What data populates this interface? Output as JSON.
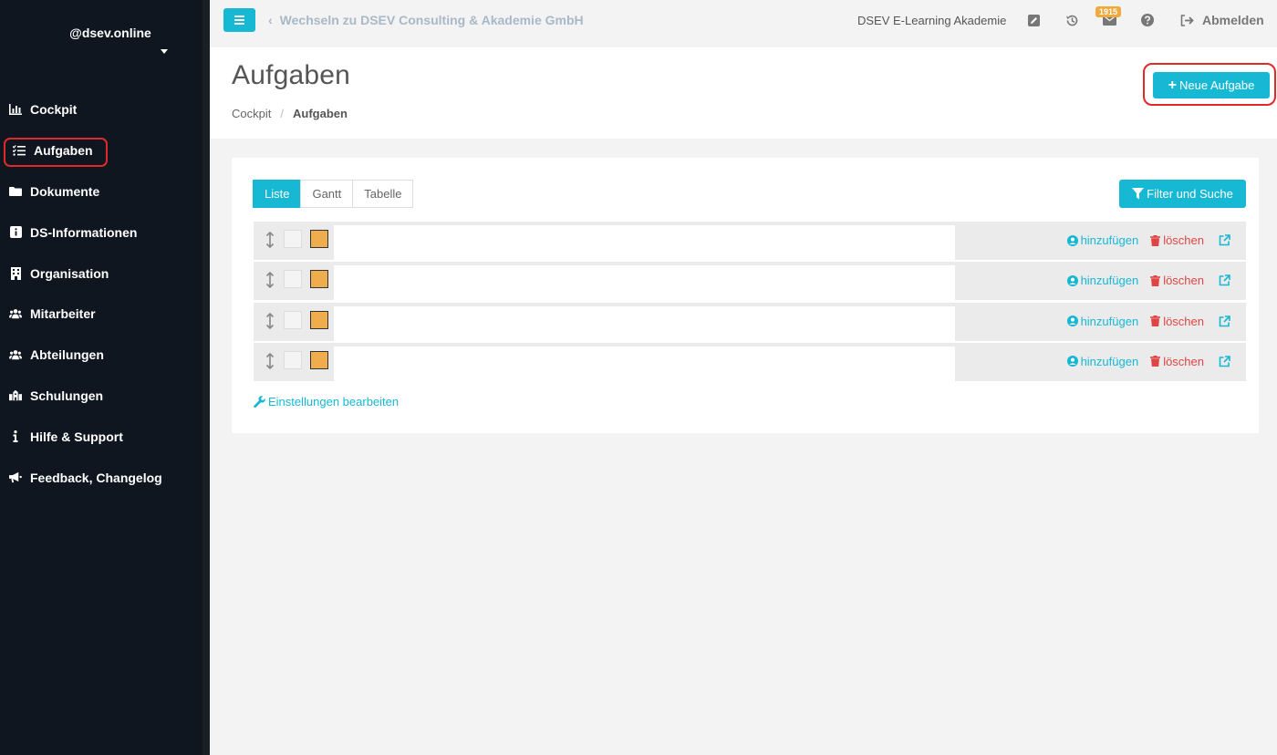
{
  "sidebar": {
    "user_name": "@dsev.online",
    "items": [
      {
        "label": "Cockpit",
        "icon": "chart-icon"
      },
      {
        "label": "Aufgaben",
        "icon": "tasks-icon"
      },
      {
        "label": "Dokumente",
        "icon": "folder-icon"
      },
      {
        "label": "DS-Informationen",
        "icon": "info-icon"
      },
      {
        "label": "Organisation",
        "icon": "building-icon"
      },
      {
        "label": "Mitarbeiter",
        "icon": "users-icon"
      },
      {
        "label": "Abteilungen",
        "icon": "users-icon"
      },
      {
        "label": "Schulungen",
        "icon": "school-icon"
      },
      {
        "label": "Hilfe & Support",
        "icon": "info-icon"
      },
      {
        "label": "Feedback, Changelog",
        "icon": "megaphone-icon"
      }
    ]
  },
  "topbar": {
    "switch_label": "Wechseln zu DSEV Consulting & Akademie GmbH",
    "org_label": "DSEV E-Learning Akademie",
    "mail_badge": "1915",
    "logout_label": "Abmelden"
  },
  "header": {
    "title": "Aufgaben",
    "breadcrumb": {
      "root": "Cockpit",
      "separator": "/",
      "current": "Aufgaben"
    },
    "new_task_label": "Neue Aufgabe"
  },
  "main": {
    "tabs": [
      {
        "label": "Liste",
        "active": true
      },
      {
        "label": "Gantt",
        "active": false
      },
      {
        "label": "Tabelle",
        "active": false
      }
    ],
    "filter_label": "Filter und Suche",
    "row_actions": {
      "add": "hinzufügen",
      "delete": "löschen"
    },
    "rows": [
      {},
      {},
      {},
      {}
    ],
    "settings_label": "Einstellungen bearbeiten"
  },
  "colors": {
    "accent": "#17b8d4",
    "sidebar_bg": "#0f1620",
    "priority": "#f0ad4e",
    "danger": "#e04444",
    "highlight": "#e02a2a"
  }
}
